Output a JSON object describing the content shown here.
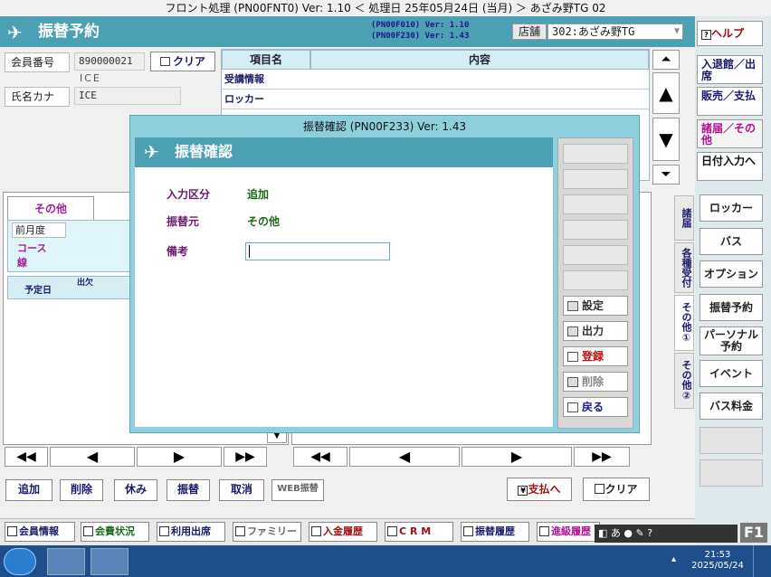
{
  "window": {
    "title": "フロント処理 (PN00FNT0) Ver: 1.10 ＜ 処理日 25年05月24日 (当月) ＞ あざみ野TG 02"
  },
  "header": {
    "title": "振替予約",
    "ver1": "(PN00F010)  Ver: 1.10",
    "ver2": "(PN00F230)  Ver: 1.43",
    "store_label": "店舗",
    "store_value": "302:あざみ野TG"
  },
  "member": {
    "no_label": "会員番号",
    "no_value": "890000021",
    "clear_label": "クリア",
    "name_romaji": "ICE",
    "kana_label": "氏名カナ",
    "kana_value": "ICE"
  },
  "item_grid": {
    "col1": "項目名",
    "col2": "内容",
    "rows": [
      "受講情報",
      "ロッカー"
    ]
  },
  "left_panel": {
    "tab": "その他",
    "prev_year": "前月度",
    "course": "コース",
    "line": "線",
    "col_date": "予定日",
    "col_attend": "出欠"
  },
  "actions": {
    "add": "追加",
    "delete": "削除",
    "rest": "休み",
    "transfer": "振替",
    "cancel": "取消",
    "web": "WEB振替",
    "to_pay": "支払へ",
    "clear": "クリア"
  },
  "right_menu": {
    "help": "ヘルプ",
    "entry": "入退館／出席",
    "sales": "販売／支払",
    "notice": "諸届／その他",
    "date_input": "日付入力へ"
  },
  "vtabs": [
    "諸届",
    "各種受付",
    "その他①",
    "その他②"
  ],
  "right_buttons": [
    "ロッカー",
    "バス",
    "オプション",
    "振替予約",
    "パーソナル予約",
    "イベント",
    "バス料金"
  ],
  "footer_buttons": [
    "会員情報",
    "会費状況",
    "利用出席",
    "ファミリー",
    "入金履歴",
    "C R M",
    "振替履歴",
    "進級履歴"
  ],
  "modal": {
    "window_title": "振替確認 (PN00F233) Ver: 1.43",
    "title": "振替確認",
    "input_type_label": "入力区分",
    "input_type_value": "追加",
    "source_label": "振替元",
    "source_value": "その他",
    "note_label": "備考",
    "note_value": "",
    "side_buttons": {
      "setting": "設定",
      "output": "出力",
      "register": "登録",
      "delete": "削除",
      "back": "戻る"
    }
  },
  "ime": {
    "f1": "F1"
  },
  "taskbar": {
    "time": "21:53",
    "date": "2025/05/24"
  }
}
